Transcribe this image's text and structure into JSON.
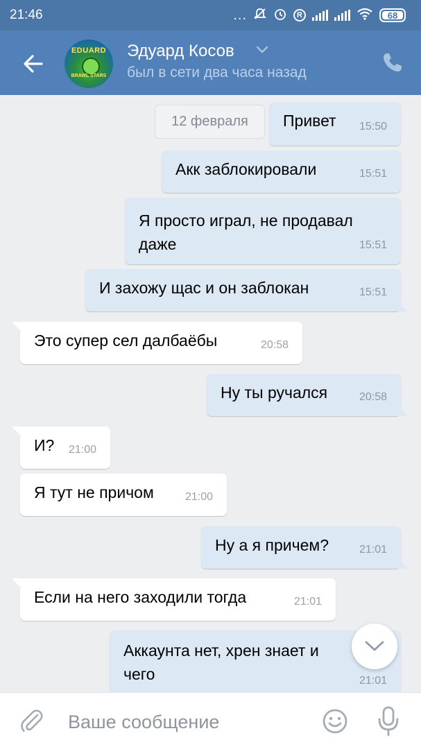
{
  "status_bar": {
    "time": "21:46",
    "dots": "...",
    "battery": "68",
    "r_icon": "R",
    "icons": [
      "mute-icon",
      "alarm-icon",
      "r-icon",
      "signal-icon",
      "signal-icon",
      "wifi-icon",
      "battery-icon"
    ]
  },
  "header": {
    "contact_name": "Эдуард Косов",
    "status": "был в сети два часа назад",
    "avatar_text_top": "EDUARD",
    "avatar_text_bottom": "BRAWL STARS",
    "icons": [
      "back-arrow-icon",
      "chevron-down-icon",
      "phone-icon"
    ]
  },
  "chat": {
    "date_chip": "12 февраля",
    "messages": [
      {
        "dir": "out",
        "text": "Привет",
        "time": "15:50"
      },
      {
        "dir": "out",
        "text": "Акк заблокировали",
        "time": "15:51"
      },
      {
        "dir": "out",
        "text_line1": "Я просто играл, не продавал",
        "text_line2": "даже",
        "time": "15:51"
      },
      {
        "dir": "out",
        "text": "И захожу щас и он заблокан",
        "time": "15:51"
      },
      {
        "dir": "in",
        "text": "Это супер сел далбаёбы",
        "time": "20:58"
      },
      {
        "dir": "out",
        "text": "Ну ты ручался",
        "time": "20:58"
      },
      {
        "dir": "in",
        "text": "И?",
        "time": "21:00"
      },
      {
        "dir": "in",
        "text": "Я тут не причом",
        "time": "21:00"
      },
      {
        "dir": "out",
        "text": "Ну а я причем?",
        "time": "21:01"
      },
      {
        "dir": "in",
        "text": "Если на него заходили тогда",
        "time": "21:01"
      },
      {
        "dir": "out",
        "text_line1": "Аккаунта нет, хрен знает и",
        "text_line2": "чего",
        "time": "21:01"
      }
    ]
  },
  "input_bar": {
    "placeholder": "Ваше сообщение",
    "icons": [
      "paperclip-icon",
      "emoji-icon",
      "microphone-icon"
    ]
  },
  "colors": {
    "status_bar": "#4a76a8",
    "header": "#5181b8",
    "background": "#edeef0",
    "outgoing_bubble": "#dde8f5",
    "incoming_bubble": "#ffffff"
  }
}
